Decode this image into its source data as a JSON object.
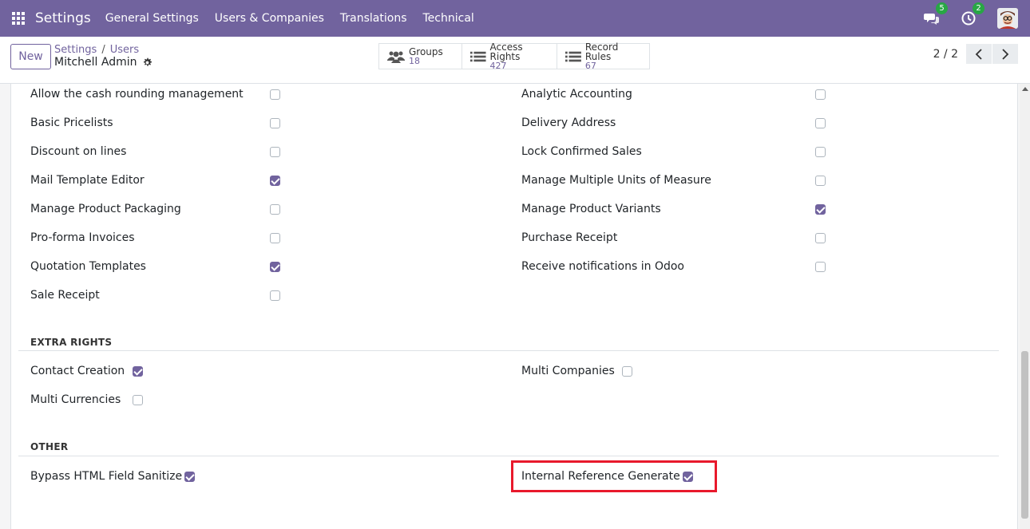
{
  "navbar": {
    "brand": "Settings",
    "menus": [
      "General Settings",
      "Users & Companies",
      "Translations",
      "Technical"
    ],
    "messages_badge": "5",
    "activities_badge": "2"
  },
  "control_panel": {
    "new_label": "New",
    "breadcrumb": [
      "Settings",
      "Users"
    ],
    "record_name": "Mitchell Admin",
    "smart_buttons": [
      {
        "label": "Groups",
        "value": "18",
        "icon": "users-icon"
      },
      {
        "label": "Access Rights",
        "value": "427",
        "icon": "list-icon"
      },
      {
        "label": "Record Rules",
        "value": "67",
        "icon": "list-icon"
      }
    ],
    "pager": "2 / 2"
  },
  "left_column": [
    {
      "label": "Allow the cash rounding management",
      "checked": false
    },
    {
      "label": "Basic Pricelists",
      "checked": false
    },
    {
      "label": "Discount on lines",
      "checked": false
    },
    {
      "label": "Mail Template Editor",
      "checked": true
    },
    {
      "label": "Manage Product Packaging",
      "checked": false
    },
    {
      "label": "Pro-forma Invoices",
      "checked": false
    },
    {
      "label": "Quotation Templates",
      "checked": true
    },
    {
      "label": "Sale Receipt",
      "checked": false
    }
  ],
  "right_column": [
    {
      "label": "Analytic Accounting",
      "checked": false
    },
    {
      "label": "Delivery Address",
      "checked": false
    },
    {
      "label": "Lock Confirmed Sales",
      "checked": false
    },
    {
      "label": "Manage Multiple Units of Measure",
      "checked": false
    },
    {
      "label": "Manage Product Variants",
      "checked": true
    },
    {
      "label": "Purchase Receipt",
      "checked": false
    },
    {
      "label": "Receive notifications in Odoo",
      "checked": false
    }
  ],
  "extra_rights": {
    "title": "EXTRA RIGHTS",
    "items": [
      {
        "label": "Contact Creation",
        "checked": true
      },
      {
        "label": "Multi Currencies",
        "checked": false
      },
      {
        "label": "Multi Companies",
        "checked": false
      }
    ]
  },
  "other": {
    "title": "OTHER",
    "items": [
      {
        "label": "Bypass HTML Field Sanitize",
        "checked": true
      },
      {
        "label": "Internal Reference Generate",
        "checked": true
      }
    ]
  }
}
